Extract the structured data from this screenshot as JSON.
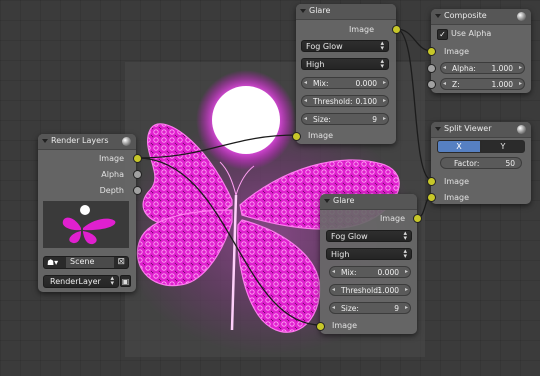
{
  "nodes": {
    "glare_top": {
      "title": "Glare",
      "output_label": "Image",
      "type_value": "Fog Glow",
      "quality_value": "High",
      "mix_label": "Mix:",
      "mix_value": "0.000",
      "threshold_label": "Threshold:",
      "threshold_value": "0.100",
      "size_label": "Size:",
      "size_value": "9",
      "input_label": "Image"
    },
    "composite": {
      "title": "Composite",
      "use_alpha_label": "Use Alpha",
      "use_alpha_checked": true,
      "image_label": "Image",
      "alpha_label": "Alpha:",
      "alpha_value": "1.000",
      "z_label": "Z:",
      "z_value": "1.000"
    },
    "split_viewer": {
      "title": "Split Viewer",
      "x_label": "X",
      "y_label": "Y",
      "factor_label": "Factor:",
      "factor_value": "50",
      "image1_label": "Image",
      "image2_label": "Image"
    },
    "render_layers": {
      "title": "Render Layers",
      "image_label": "Image",
      "alpha_label": "Alpha",
      "depth_label": "Depth",
      "scene_value": "Scene",
      "layer_value": "RenderLayer"
    },
    "glare_bottom": {
      "title": "Glare",
      "output_label": "Image",
      "type_value": "Fog Glow",
      "quality_value": "High",
      "mix_label": "Mix:",
      "mix_value": "0.000",
      "threshold_label": "Threshold:",
      "threshold_value": "1.000",
      "size_label": "Size:",
      "size_value": "9",
      "input_label": "Image"
    }
  },
  "colors": {
    "socket_color": "#c7c729",
    "accent_blue": "#5680c2",
    "butterfly_magenta": "#ff2ee0",
    "glow": "#ff44ff"
  }
}
